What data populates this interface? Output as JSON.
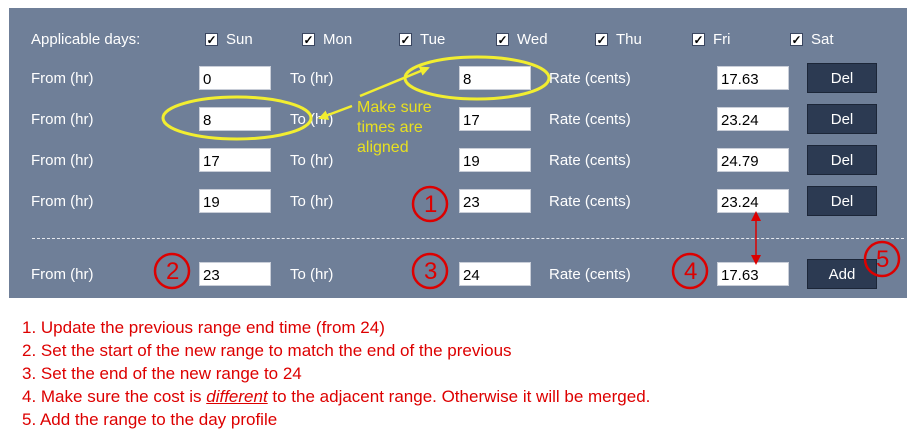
{
  "applicable_days": {
    "label": "Applicable days:",
    "days": [
      {
        "label": "Sun",
        "checked": true
      },
      {
        "label": "Mon",
        "checked": true
      },
      {
        "label": "Tue",
        "checked": true
      },
      {
        "label": "Wed",
        "checked": true
      },
      {
        "label": "Thu",
        "checked": true
      },
      {
        "label": "Fri",
        "checked": true
      },
      {
        "label": "Sat",
        "checked": true
      }
    ],
    "check_glyph": "✓"
  },
  "labels": {
    "from": "From (hr)",
    "to": "To (hr)",
    "rate": "Rate (cents)"
  },
  "ranges": [
    {
      "from": "0",
      "to": "8",
      "rate": "17.63",
      "button": "Del"
    },
    {
      "from": "8",
      "to": "17",
      "rate": "23.24",
      "button": "Del"
    },
    {
      "from": "17",
      "to": "19",
      "rate": "24.79",
      "button": "Del"
    },
    {
      "from": "19",
      "to": "23",
      "rate": "23.24",
      "button": "Del"
    }
  ],
  "new_range": {
    "from": "23",
    "to": "24",
    "rate": "17.63",
    "button": "Add"
  },
  "annotations": {
    "callout": [
      "Make sure",
      "times are",
      "aligned"
    ],
    "markers": [
      "1",
      "2",
      "3",
      "4",
      "5"
    ],
    "notes": [
      {
        "text": "1. Update the previous range end time (from 24)"
      },
      {
        "text": "2. Set the start of the new range to match the end of the previous"
      },
      {
        "text": "3. Set the end of the new range to 24"
      },
      {
        "pre": "4. Make sure the cost is ",
        "em": "different",
        "post": " to the adjacent range. Otherwise it will be merged."
      },
      {
        "text": "5. Add the range to the day profile"
      }
    ]
  },
  "colors": {
    "panel": "#6f7f98",
    "button": "#2c3a52",
    "highlight": "#f2ee30",
    "annotation_red": "#dd0000"
  }
}
